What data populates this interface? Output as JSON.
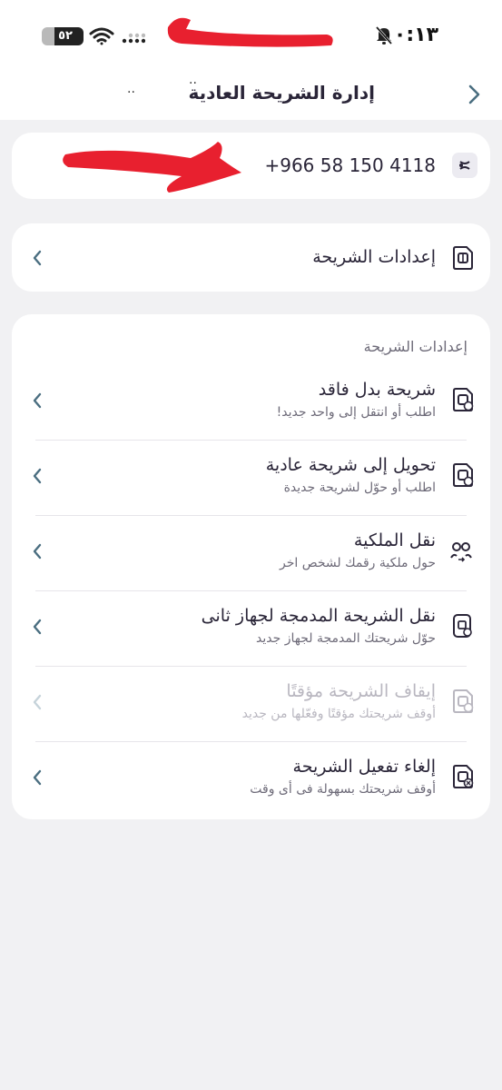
{
  "status_bar": {
    "time": "٠٠:١٣",
    "battery": "٥٢"
  },
  "header": {
    "title": "إدارة الشريحة العادية",
    "dots_a": "..",
    "dots_b": "··"
  },
  "sim_card": {
    "phone_number": "+966 58 150 4118"
  },
  "sim_settings": {
    "label": "إعدادات الشريحة"
  },
  "section": {
    "label": "إعدادات الشريحة",
    "items": [
      {
        "title": "شريحة بدل فاقد",
        "subtitle": "اطلب أو انتقل إلى واحد جديد!",
        "disabled": false
      },
      {
        "title": "تحويل إلى شريحة عادية",
        "subtitle": "اطلب أو حوّل لشريحة جديدة",
        "disabled": false
      },
      {
        "title": "نقل الملكية",
        "subtitle": "حول ملكية رقمك لشخص اخر",
        "disabled": false
      },
      {
        "title": "نقل الشريحة المدمجة لجهاز ثانى",
        "subtitle": "حوّل شريحتك المدمجة لجهاز جديد",
        "disabled": false
      },
      {
        "title": "إيقاف الشريحة مؤقتًا",
        "subtitle": "أوقف شريحتك مؤقتًا وفعّلها من جديد",
        "disabled": true
      },
      {
        "title": "إلغاء تفعيل الشريحة",
        "subtitle": "أوقف شريحتك بسهولة فى أى وقت",
        "disabled": false
      }
    ]
  },
  "colors": {
    "background": "#f1f1f3",
    "card": "#ffffff",
    "text": "#2a2538",
    "muted": "#6d6a78",
    "chevron": "#4a6e80",
    "redaction": "#e8202f"
  },
  "icons": {
    "back": "chevron-right-icon",
    "row": "chevron-left-icon",
    "sim": "sim-card-icon",
    "transfer": "transfer-ownership-icon",
    "esim": "esim-device-icon",
    "pause": "sim-pause-icon",
    "cancel": "sim-cancel-icon"
  }
}
